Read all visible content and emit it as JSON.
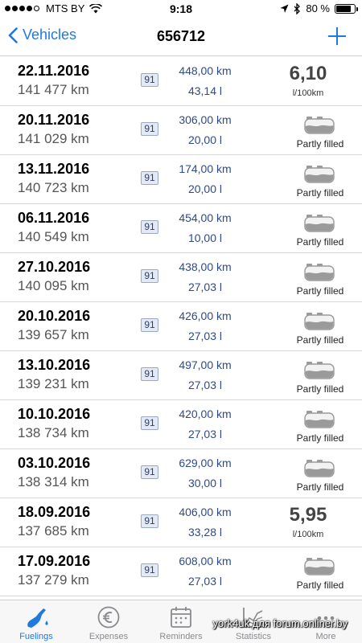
{
  "status_bar": {
    "carrier": "MTS BY",
    "time": "9:18",
    "battery": "80 %",
    "battery_level": 0.8
  },
  "nav": {
    "back_label": "Vehicles",
    "title": "656712",
    "accent_color": "#1f7ae0"
  },
  "fuelings": [
    {
      "date": "22.11.2016",
      "odometer": "141 477 km",
      "octane": "91",
      "distance": "448,00 km",
      "volume": "43,14 l",
      "type": "consumption",
      "consumption": "6,10",
      "unit": "l/100km"
    },
    {
      "date": "20.11.2016",
      "odometer": "141 029 km",
      "octane": "91",
      "distance": "306,00 km",
      "volume": "20,00 l",
      "type": "partly",
      "status": "Partly filled"
    },
    {
      "date": "13.11.2016",
      "odometer": "140 723 km",
      "octane": "91",
      "distance": "174,00 km",
      "volume": "20,00 l",
      "type": "partly",
      "status": "Partly filled"
    },
    {
      "date": "06.11.2016",
      "odometer": "140 549 km",
      "octane": "91",
      "distance": "454,00 km",
      "volume": "10,00 l",
      "type": "partly",
      "status": "Partly filled"
    },
    {
      "date": "27.10.2016",
      "odometer": "140 095 km",
      "octane": "91",
      "distance": "438,00 km",
      "volume": "27,03 l",
      "type": "partly",
      "status": "Partly filled"
    },
    {
      "date": "20.10.2016",
      "odometer": "139 657 km",
      "octane": "91",
      "distance": "426,00 km",
      "volume": "27,03 l",
      "type": "partly",
      "status": "Partly filled"
    },
    {
      "date": "13.10.2016",
      "odometer": "139 231 km",
      "octane": "91",
      "distance": "497,00 km",
      "volume": "27,03 l",
      "type": "partly",
      "status": "Partly filled"
    },
    {
      "date": "10.10.2016",
      "odometer": "138 734 km",
      "octane": "91",
      "distance": "420,00 km",
      "volume": "27,03 l",
      "type": "partly",
      "status": "Partly filled"
    },
    {
      "date": "03.10.2016",
      "odometer": "138 314 km",
      "octane": "91",
      "distance": "629,00 km",
      "volume": "30,00 l",
      "type": "partly",
      "status": "Partly filled"
    },
    {
      "date": "18.09.2016",
      "odometer": "137 685 km",
      "octane": "91",
      "distance": "406,00 km",
      "volume": "33,28 l",
      "type": "consumption",
      "consumption": "5,95",
      "unit": "l/100km"
    },
    {
      "date": "17.09.2016",
      "odometer": "137 279 km",
      "octane": "91",
      "distance": "608,00 km",
      "volume": "27,03 l",
      "type": "partly",
      "status": "Partly filled"
    }
  ],
  "tabs": [
    {
      "label": "Fuelings",
      "icon": "fuel-nozzle-icon",
      "active": true
    },
    {
      "label": "Expenses",
      "icon": "euro-coin-icon",
      "active": false
    },
    {
      "label": "Reminders",
      "icon": "calendar-icon",
      "active": false
    },
    {
      "label": "Statistics",
      "icon": "chart-icon",
      "active": false
    },
    {
      "label": "More",
      "icon": "more-dots-icon",
      "active": false
    }
  ],
  "watermark": "york4uk для forum.onliner.by"
}
